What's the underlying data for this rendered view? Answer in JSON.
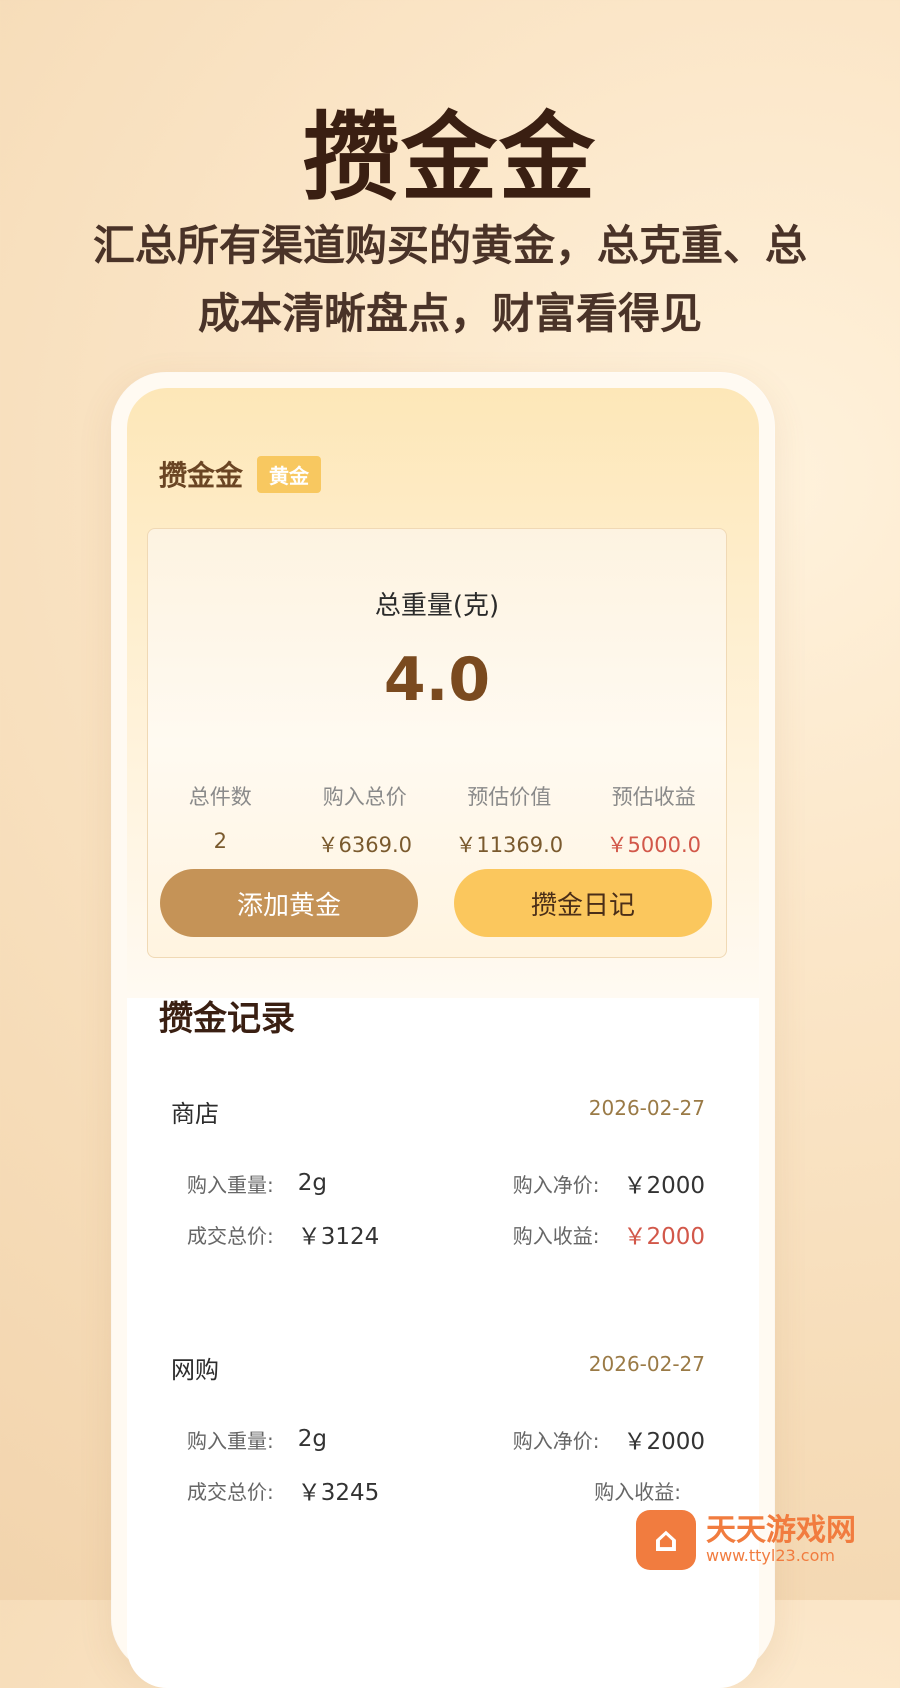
{
  "promo": {
    "title": "攒金金",
    "subtitle_line1": "汇总所有渠道购买的黄金，总克重、总",
    "subtitle_line2": "成本清晰盘点，财富看得见"
  },
  "app": {
    "name": "攒金金",
    "badge": "黄金",
    "summary": {
      "weight_label": "总重量(克)",
      "weight_value": "4.0",
      "stats": [
        {
          "label": "总件数",
          "value": "2"
        },
        {
          "label": "购入总价",
          "value": "￥6369.0"
        },
        {
          "label": "预估价值",
          "value": "￥11369.0"
        },
        {
          "label": "预估收益",
          "value": "￥5000.0"
        }
      ],
      "buttons": {
        "add_label": "添加黄金",
        "diary_label": "攒金日记"
      }
    },
    "records": {
      "title": "攒金记录",
      "items": [
        {
          "name": "商店",
          "date": "2026-02-27",
          "weight_label": "购入重量:",
          "weight_value": "2g",
          "net_price_label": "购入净价:",
          "net_price_value": "￥2000",
          "total_label": "成交总价:",
          "total_value": "￥3124",
          "profit_label": "购入收益:",
          "profit_value": "￥2000"
        },
        {
          "name": "网购",
          "date": "2026-02-27",
          "weight_label": "购入重量:",
          "weight_value": "2g",
          "net_price_label": "购入净价:",
          "net_price_value": "￥2000",
          "total_label": "成交总价:",
          "total_value": "￥3245",
          "profit_label": "购入收益:",
          "profit_value": ""
        }
      ]
    }
  },
  "watermark": {
    "main": "天天游戏网",
    "sub": "www.ttyl23.com",
    "logo_icon": "gift-box-icon"
  },
  "colors": {
    "accent": "#c59357",
    "accent_light": "#fbc75d",
    "red": "#d2584a"
  }
}
